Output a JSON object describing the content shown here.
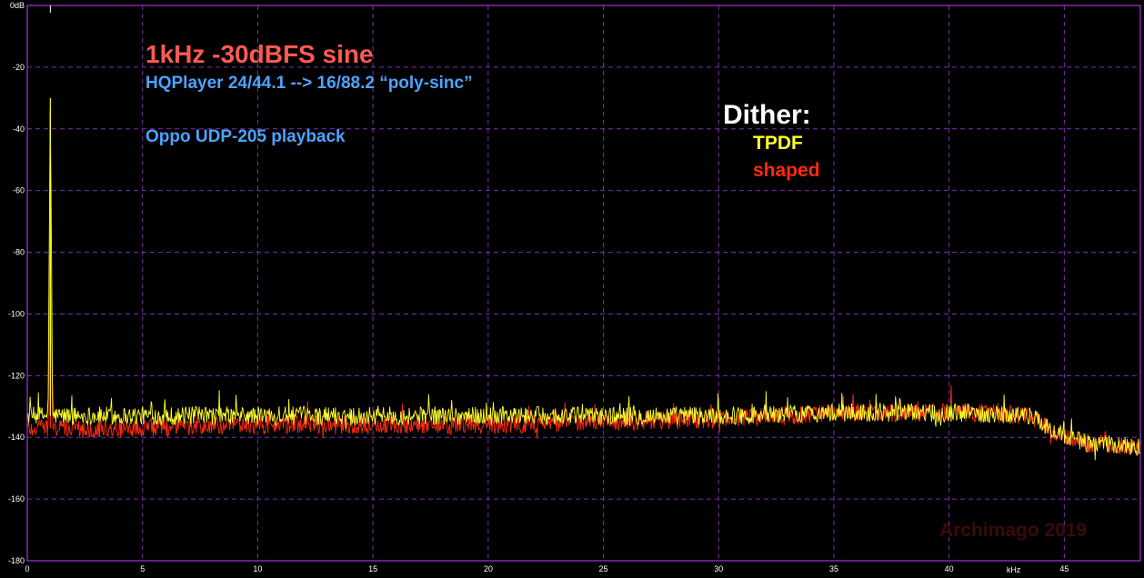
{
  "chart_data": {
    "type": "line",
    "title": "1kHz -30dBFS sine",
    "subtitle": "HQPlayer 24/44.1 --> 16/88.2 “poly-sinc”",
    "note": "Oppo UDP-205 playback",
    "legend_title": "Dither:",
    "xlabel": "kHz",
    "ylabel": "",
    "y_top_label": "0dB",
    "xlim": [
      0,
      48.3
    ],
    "ylim": [
      -180,
      0
    ],
    "xticks": [
      0,
      5,
      10,
      15,
      20,
      25,
      30,
      35,
      40,
      45
    ],
    "xtick_labels": [
      "0",
      "5",
      "10",
      "15",
      "20",
      "25",
      "30",
      "35",
      "40",
      "45"
    ],
    "yticks": [
      -20,
      -40,
      -60,
      -80,
      -100,
      -120,
      -140,
      -160,
      -180
    ],
    "ytick_labels": [
      "-20",
      "-40",
      "-60",
      "-80",
      "-100",
      "-120",
      "-140",
      "-160",
      "-180"
    ],
    "grid": true,
    "legend_position": "right",
    "series": [
      {
        "name": "TPDF",
        "color": "#ffff2a",
        "x": [
          0,
          0.9,
          1.0,
          1.1,
          2,
          5,
          10,
          15,
          20,
          25,
          30,
          35,
          38,
          41,
          43.5,
          44.5,
          46,
          48.3
        ],
        "y": [
          -133,
          -133,
          -30,
          -133,
          -133,
          -133,
          -133,
          -133,
          -133,
          -133,
          -133,
          -132,
          -132,
          -132,
          -133,
          -138,
          -142,
          -143
        ]
      },
      {
        "name": "shaped",
        "color": "#ff2a10",
        "x": [
          0,
          0.9,
          1.0,
          1.1,
          2,
          5,
          10,
          15,
          20,
          25,
          30,
          33,
          35,
          38,
          41,
          43.5,
          44.5,
          46,
          48.3
        ],
        "y": [
          -137,
          -137,
          -81,
          -137,
          -137,
          -137,
          -136,
          -136,
          -136,
          -135,
          -134,
          -133,
          -132,
          -132,
          -132,
          -133,
          -138,
          -142,
          -143
        ]
      }
    ],
    "watermark": "Archimago 2019"
  },
  "colors": {
    "background": "#000000",
    "frame": "#c040ff",
    "grid": "#7a2fb0",
    "text": "#ffffff"
  }
}
